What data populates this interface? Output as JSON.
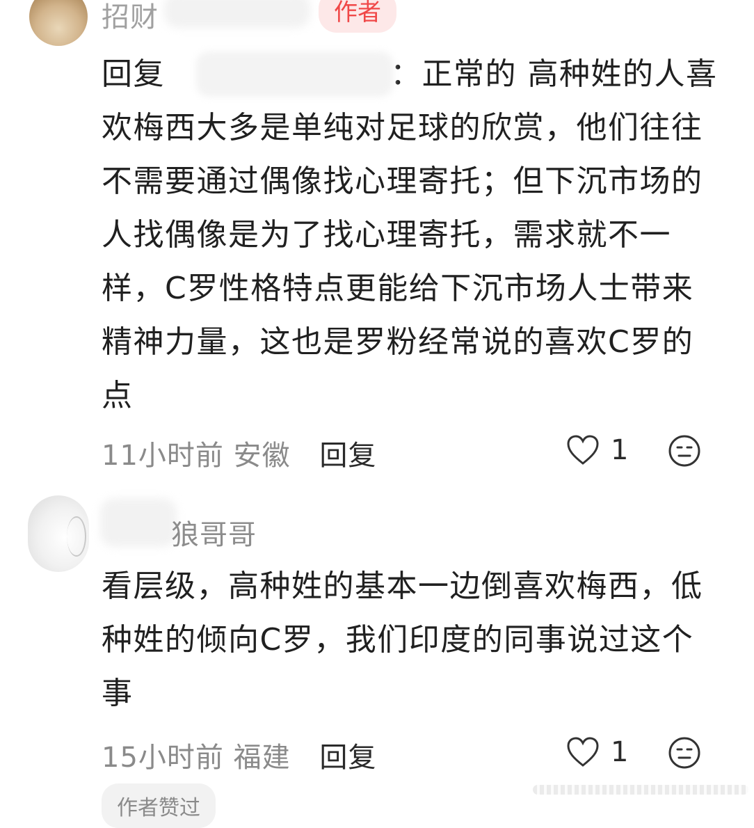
{
  "comment1": {
    "author_badge": "作者",
    "reply_prefix": "回复",
    "reply_target_suffix": "：",
    "text": "正常的 高种姓的人喜欢梅西大多是单纯对足球的欣赏，他们往往不需要通过偶像找心理寄托；但下沉市场的人找偶像是为了找心理寄托，需求就不一样，C罗性格特点更能给下沉市场人士带来精神力量，这也是罗粉经常说的喜欢C罗的点",
    "time": "11小时前",
    "location": "安徽",
    "reply_label": "回复",
    "like_count": "1"
  },
  "comment2": {
    "username_visible": "狼哥哥",
    "text": "看层级，高种姓的基本一边倒喜欢梅西，低种姓的倾向C罗，我们印度的同事说过这个事",
    "time": "15小时前",
    "location": "福建",
    "reply_label": "回复",
    "like_count": "1",
    "author_liked_label": "作者赞过"
  },
  "icons": {
    "like": "heart-outline-icon",
    "neutral": "neutral-face-icon"
  },
  "colors": {
    "badge_text": "#f04848",
    "badge_bg": "#fde8e8",
    "meta_gray": "#8a8a8a"
  }
}
